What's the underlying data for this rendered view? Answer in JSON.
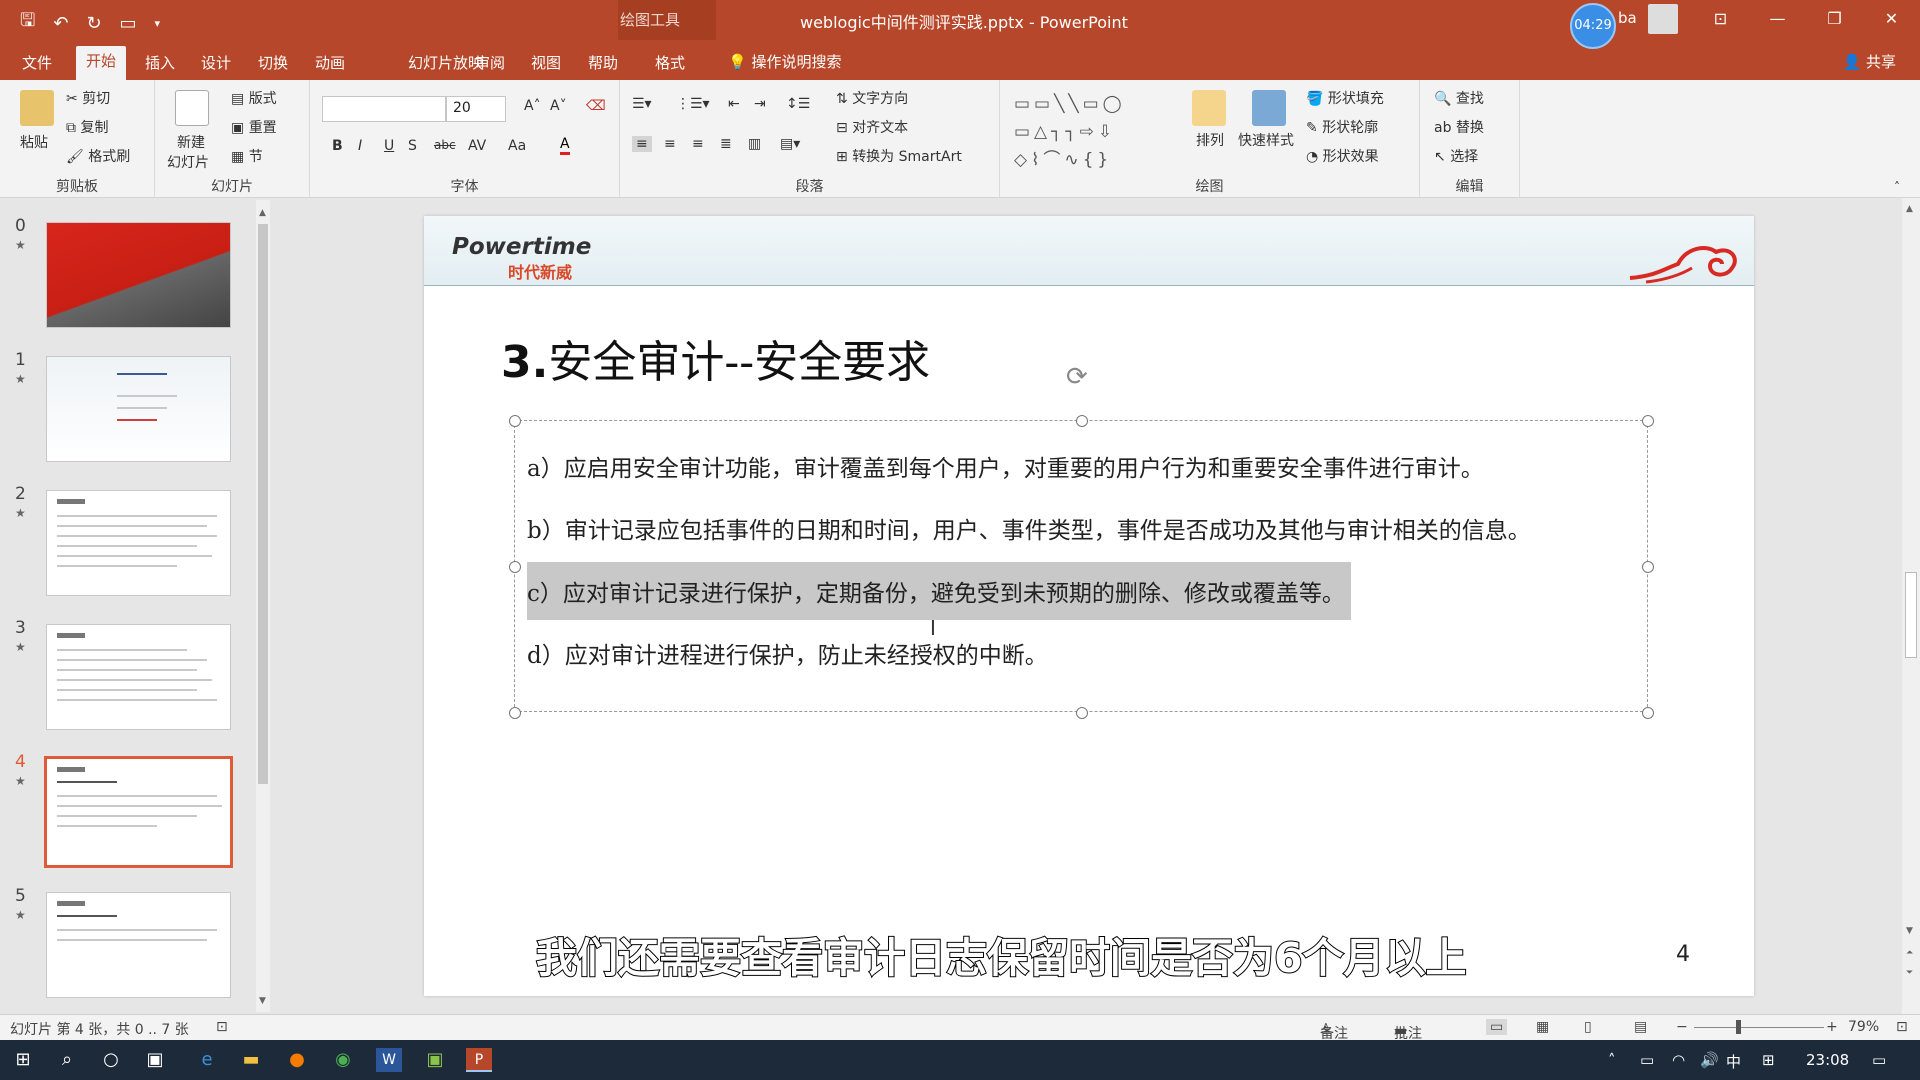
{
  "titlebar": {
    "context_label": "绘图工具",
    "document_title": "weblogic中间件测评实践.pptx - PowerPoint",
    "timer": "04:29",
    "user": "ba"
  },
  "tabs": [
    "文件",
    "开始",
    "插入",
    "设计",
    "切换",
    "动画",
    "幻灯片放映",
    "审阅",
    "视图",
    "帮助",
    "格式"
  ],
  "tell_me": "操作说明搜索",
  "share": "共享",
  "ribbon": {
    "clipboard": {
      "label": "剪贴板",
      "paste": "粘贴",
      "cut": "剪切",
      "copy": "复制",
      "format_painter": "格式刷"
    },
    "slides": {
      "label": "幻灯片",
      "new_slide": "新建",
      "new_slide2": "幻灯片",
      "layout": "版式",
      "reset": "重置",
      "section": "节"
    },
    "font": {
      "label": "字体",
      "font_name": "",
      "font_size": "20"
    },
    "paragraph": {
      "label": "段落",
      "text_direction": "文字方向",
      "align_text": "对齐文本",
      "smartart": "转换为 SmartArt"
    },
    "drawing": {
      "label": "绘图",
      "arrange": "排列",
      "quick_styles": "快速样式",
      "shape_fill": "形状填充",
      "shape_outline": "形状轮廓",
      "shape_effects": "形状效果"
    },
    "editing": {
      "label": "编辑",
      "find": "查找",
      "replace": "替换",
      "select": "选择"
    }
  },
  "thumbnails": [
    {
      "num": "0",
      "star": "★"
    },
    {
      "num": "1",
      "star": "★"
    },
    {
      "num": "2",
      "star": "★"
    },
    {
      "num": "3",
      "star": "★"
    },
    {
      "num": "4",
      "star": "★"
    },
    {
      "num": "5",
      "star": "★"
    }
  ],
  "slide": {
    "logo_main": "Powertime",
    "logo_sub": "时代新威",
    "title_num": "3.",
    "title_text": "安全审计--安全要求",
    "bullets": [
      "a）应启用安全审计功能，审计覆盖到每个用户，对重要的用户行为和重要安全事件进行审计。",
      "b）审计记录应包括事件的日期和时间，用户、事件类型，事件是否成功及其他与审计相关的信息。",
      "c）应对审计记录进行保护，定期备份，避免受到未预期的删除、修改或覆盖等。",
      "d）应对审计进程进行保护，防止未经授权的中断。"
    ],
    "page_number": "4"
  },
  "subtitle": "我们还需要查看审计日志保留时间是否为6个月以上",
  "status": {
    "slide_info": "幻灯片 第 4 张，共 0 .. 7 张",
    "notes": "备注",
    "comments": "批注",
    "zoom": "79%"
  },
  "taskbar": {
    "ime": "中",
    "time": "23:08"
  },
  "colors": {
    "accent": "#b7472a",
    "selection": "#e05a3a",
    "taskbar": "#1c2a3a"
  }
}
